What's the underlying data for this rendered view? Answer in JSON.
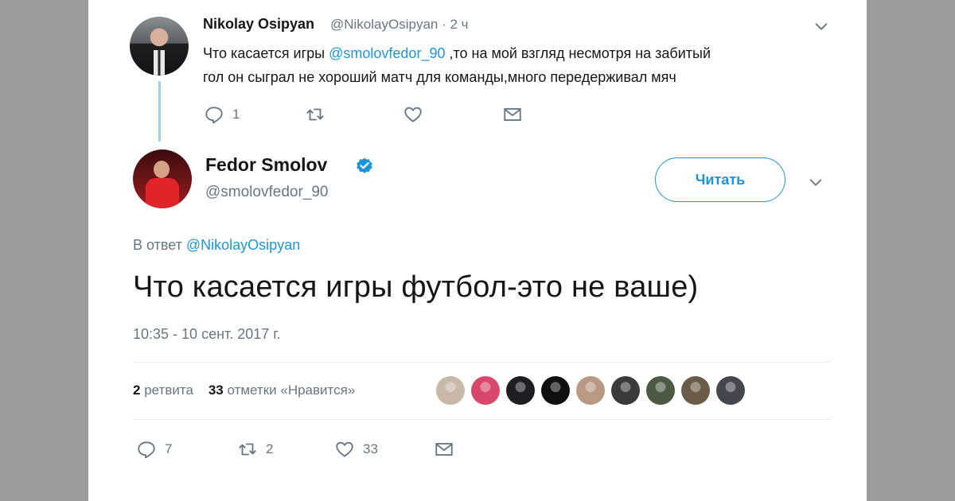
{
  "parent_tweet": {
    "author_name": "Nikolay Osipyan",
    "author_handle_time": "@NikolayOsipyan · 2 ч",
    "text_before_mention": "Что касается игры ",
    "mention": "@smolovfedor_90",
    "text_line1_after": " ,то на мой взгляд несмотря на забитый",
    "text_line2": "гол он сыграл не хороший матч для команды,много передерживал мяч",
    "actions": {
      "reply_count": "1",
      "retweet_count": "",
      "like_count": ""
    }
  },
  "main_tweet": {
    "author_name": "Fedor Smolov",
    "author_handle": "@smolovfedor_90",
    "follow_label": "Читать",
    "reply_prefix": "В ответ ",
    "reply_mention": "@NikolayOsipyan",
    "text": "Что касается игры футбол-это не ваше)",
    "timestamp": "10:35 - 10 сент. 2017 г.",
    "stats": {
      "retweets_count": "2",
      "retweets_label": "ретвита",
      "likes_count": "33",
      "likes_label": "отметки «Нравится»"
    },
    "likers": [
      {
        "icon": "liker-avatar",
        "color": "#c7b8a8"
      },
      {
        "icon": "liker-avatar",
        "color": "#d9486a"
      },
      {
        "icon": "liker-avatar",
        "color": "#1e1e24"
      },
      {
        "icon": "liker-avatar",
        "color": "#0f0f12"
      },
      {
        "icon": "liker-avatar",
        "color": "#b89a84"
      },
      {
        "icon": "liker-avatar",
        "color": "#3b3a3a"
      },
      {
        "icon": "liker-avatar",
        "color": "#4d5a43"
      },
      {
        "icon": "liker-avatar",
        "color": "#6b5c4a"
      },
      {
        "icon": "liker-avatar",
        "color": "#44484e"
      }
    ],
    "actions": {
      "reply_count": "7",
      "retweet_count": "2",
      "like_count": "33"
    }
  },
  "colors": {
    "accent": "#1b95e0",
    "secondary_text": "#657786",
    "thread_line": "#9fd2f0",
    "background": "#9b9b9b"
  }
}
